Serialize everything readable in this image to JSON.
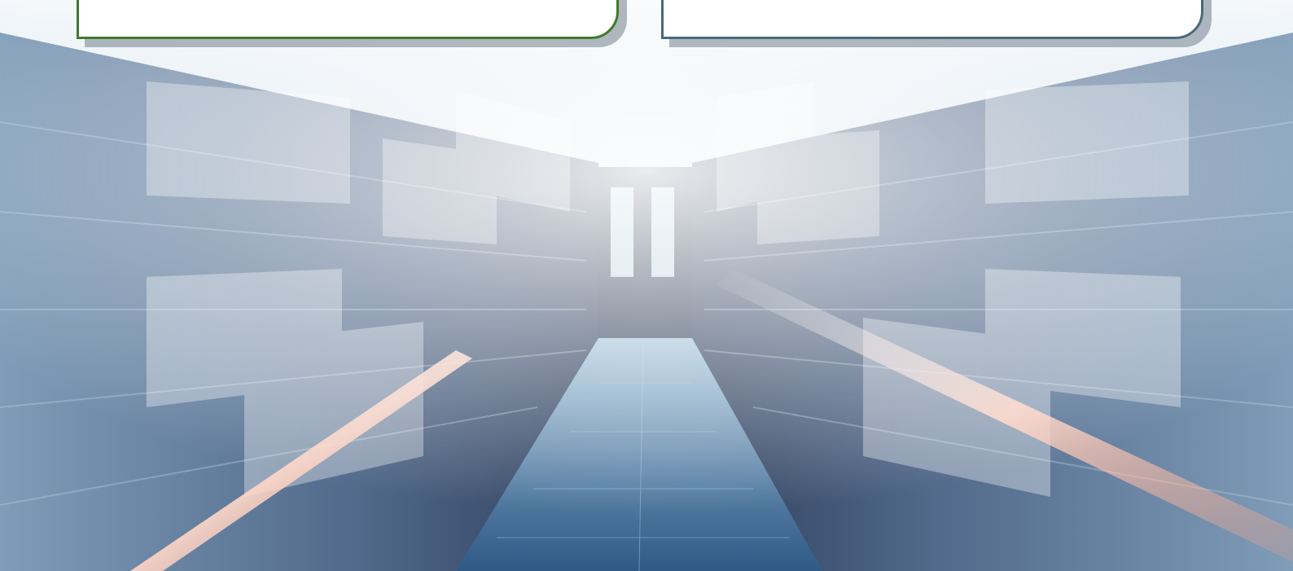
{
  "cards": [
    {
      "id": "left",
      "text": ""
    },
    {
      "id": "right",
      "text": ""
    }
  ],
  "colors": {
    "left_border": "#3f7a2b",
    "right_border": "#4b6a78",
    "floor": "#3d6c93",
    "glow": "#f2a58a"
  },
  "background": {
    "subject": "server-room-corridor"
  }
}
